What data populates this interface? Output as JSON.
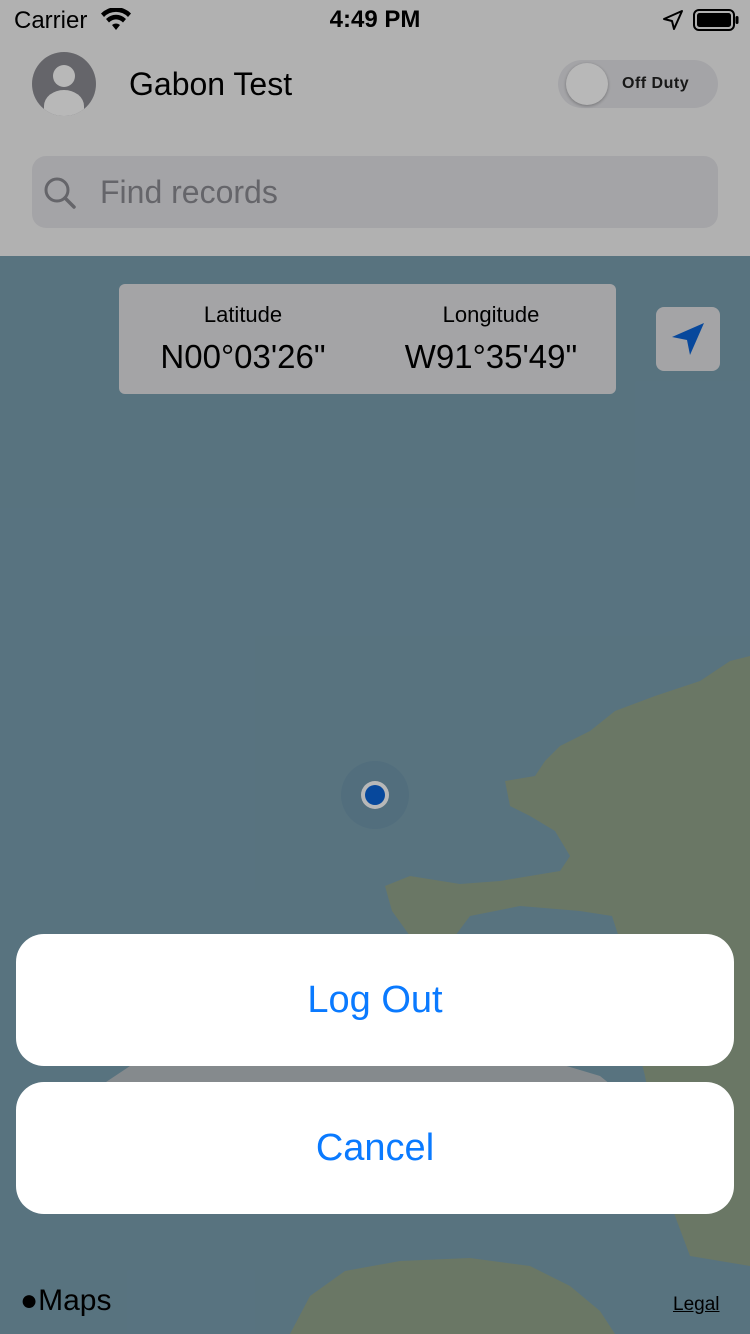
{
  "status_bar": {
    "carrier": "Carrier",
    "time": "4:49 PM"
  },
  "header": {
    "user_name": "Gabon Test",
    "duty_toggle_label": "Off Duty",
    "duty_on": false
  },
  "search": {
    "placeholder": "Find records",
    "value": ""
  },
  "coordinates": {
    "latitude_label": "Latitude",
    "latitude_value": "N00°03'26\"",
    "longitude_label": "Longitude",
    "longitude_value": "W91°35'49\""
  },
  "map": {
    "attribution": "Maps",
    "legal_label": "Legal",
    "water_color": "#7aa0b1",
    "land_color": "#93a58c"
  },
  "action_sheet": {
    "logout_label": "Log Out",
    "cancel_label": "Cancel",
    "accent_color": "#0a7aff"
  }
}
